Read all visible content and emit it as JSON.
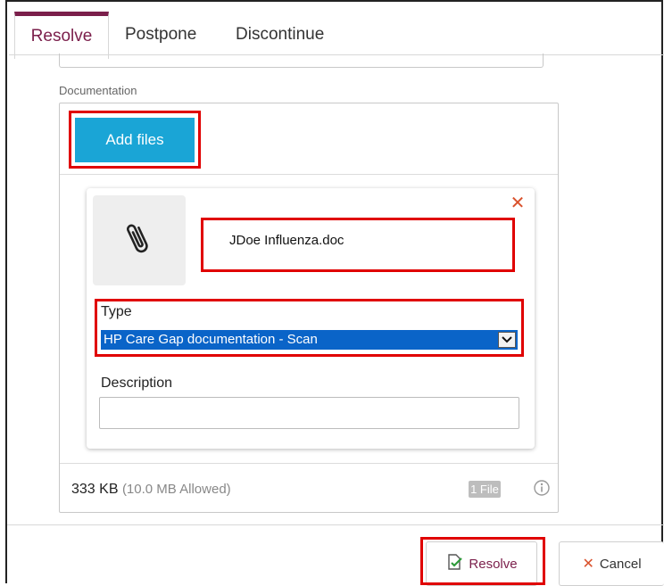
{
  "tabs": [
    {
      "label": "Resolve",
      "active": true
    },
    {
      "label": "Postpone",
      "active": false
    },
    {
      "label": "Discontinue",
      "active": false
    }
  ],
  "documentation": {
    "label": "Documentation",
    "add_files_label": "Add files",
    "attachment": {
      "file_name": "JDoe Influenza.doc",
      "icon": "paperclip-icon",
      "remove_icon": "close-icon"
    },
    "type": {
      "label": "Type",
      "selected": "HP Care Gap documentation - Scan"
    },
    "description": {
      "label": "Description",
      "value": ""
    },
    "size": "333 KB",
    "allowed": "(10.0 MB Allowed)",
    "file_count": "1 File"
  },
  "footer": {
    "resolve_label": "Resolve",
    "cancel_label": "Cancel"
  },
  "colors": {
    "accent": "#7b1f4b",
    "add_button": "#1aa5d6",
    "highlight": "#e00000",
    "select_bg": "#0a64c8",
    "cancel_x": "#d9512c"
  }
}
